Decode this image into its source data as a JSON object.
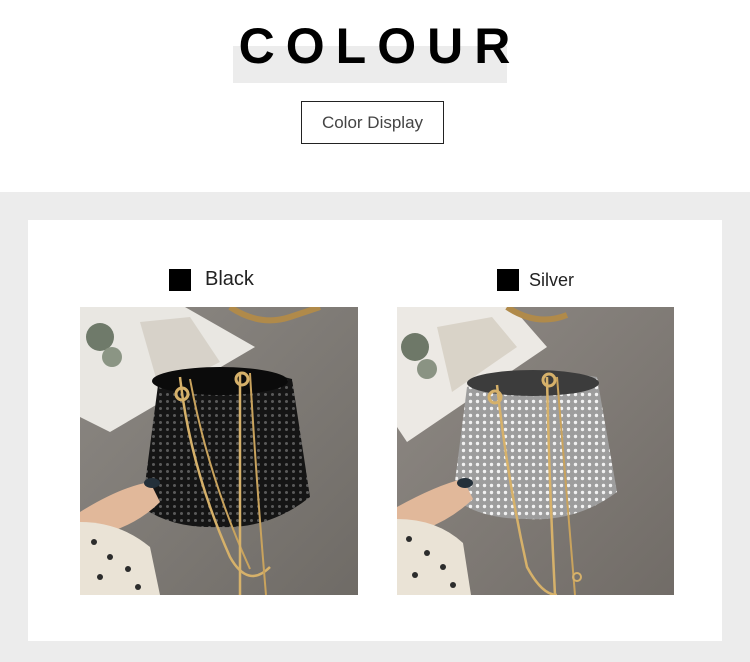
{
  "header": {
    "title": "COLOUR",
    "subtitle": "Color Display"
  },
  "variants": [
    {
      "name": "Black",
      "swatch_color": "#000000",
      "bag_color": "#141414",
      "image_icon": "black-rhinestone-bucket-bag-photo"
    },
    {
      "name": "Silver",
      "swatch_color": "#000000",
      "bag_color": "#b8b8b8",
      "image_icon": "silver-rhinestone-bucket-bag-photo"
    }
  ],
  "colors": {
    "section_background": "#ececec",
    "card_background": "#ffffff",
    "title_highlight": "#ececec",
    "chain_gold": "#d6b16a"
  }
}
